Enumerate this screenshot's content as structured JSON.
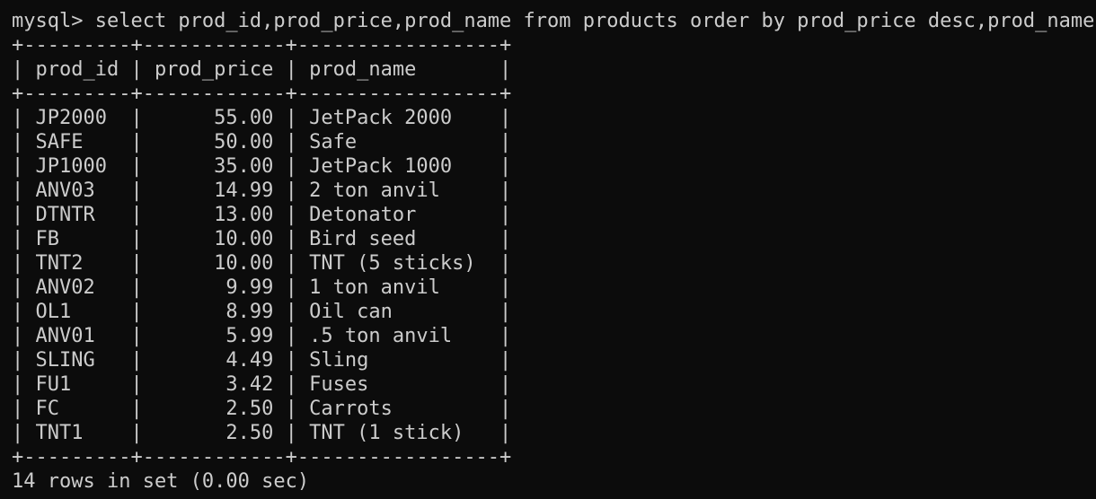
{
  "terminal": {
    "prompt": "mysql> ",
    "command": "select prod_id,prod_price,prod_name from products order by prod_price desc,prod_name;",
    "border": "+---------+------------+-----------------+",
    "header_line": "| prod_id | prod_price | prod_name       |",
    "columns": [
      "prod_id",
      "prod_price",
      "prod_name"
    ],
    "rows": [
      {
        "id": "JP2000",
        "price": "55.00",
        "name": "JetPack 2000"
      },
      {
        "id": "SAFE",
        "price": "50.00",
        "name": "Safe"
      },
      {
        "id": "JP1000",
        "price": "35.00",
        "name": "JetPack 1000"
      },
      {
        "id": "ANV03",
        "price": "14.99",
        "name": "2 ton anvil"
      },
      {
        "id": "DTNTR",
        "price": "13.00",
        "name": "Detonator"
      },
      {
        "id": "FB",
        "price": "10.00",
        "name": "Bird seed"
      },
      {
        "id": "TNT2",
        "price": "10.00",
        "name": "TNT (5 sticks)"
      },
      {
        "id": "ANV02",
        "price": "9.99",
        "name": "1 ton anvil"
      },
      {
        "id": "OL1",
        "price": "8.99",
        "name": "Oil can"
      },
      {
        "id": "ANV01",
        "price": "5.99",
        "name": ".5 ton anvil"
      },
      {
        "id": "SLING",
        "price": "4.49",
        "name": "Sling"
      },
      {
        "id": "FU1",
        "price": "3.42",
        "name": "Fuses"
      },
      {
        "id": "FC",
        "price": "2.50",
        "name": "Carrots"
      },
      {
        "id": "TNT1",
        "price": "2.50",
        "name": "TNT (1 stick)"
      }
    ],
    "footer": "14 rows in set (0.00 sec)",
    "colors": {
      "background": "#0c0c0c",
      "text": "#cccccc"
    }
  }
}
